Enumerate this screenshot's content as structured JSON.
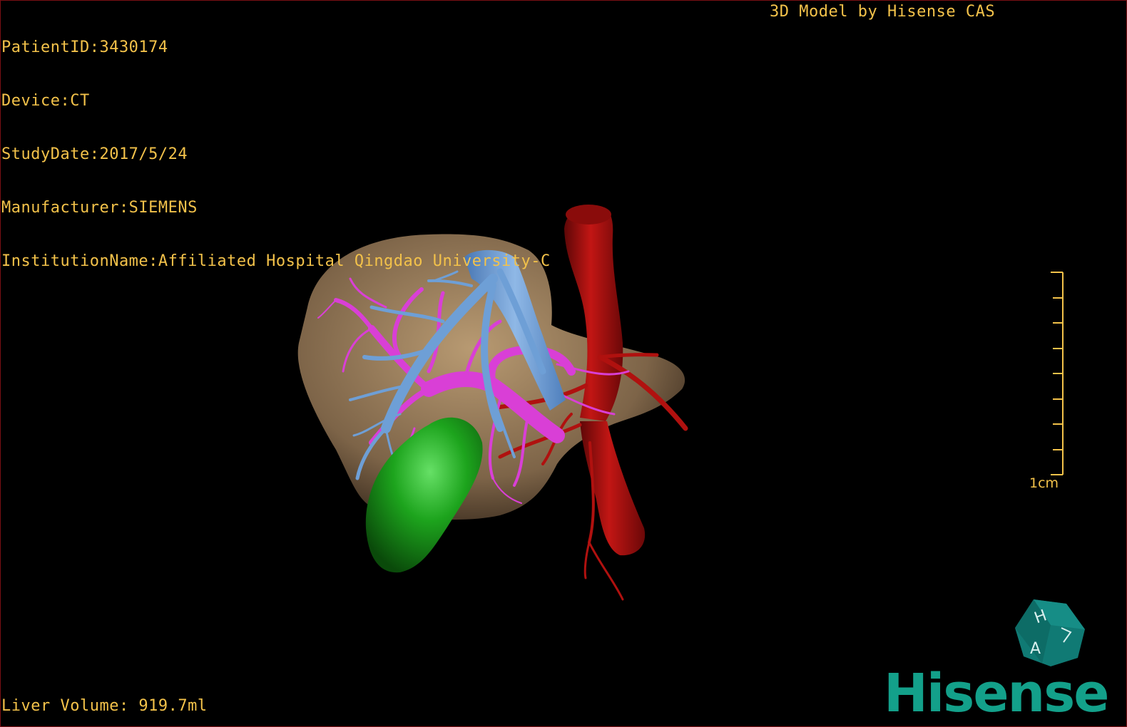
{
  "overlay": {
    "patient_id": "PatientID:3430174",
    "device": "Device:CT",
    "study_date": "StudyDate:2017/5/24",
    "manufacturer": "Manufacturer:SIEMENS",
    "institution": "InstitutionName:Affiliated Hospital Qingdao University-C",
    "model_credit": "3D Model by Hisense CAS",
    "liver_volume": "Liver Volume: 919.7ml"
  },
  "scale_bar": {
    "label": "1cm"
  },
  "orientation_cube": {
    "icon": "orientation-cube-icon",
    "faces": [
      "H",
      "A"
    ]
  },
  "branding": {
    "wordmark": "Hisense"
  },
  "colors": {
    "overlay_text": "#f3c24a",
    "liver": "#7d6448",
    "hepatic_vein": "#6e9fd6",
    "portal_vein": "#d93fd6",
    "artery_ivc": "#b0110f",
    "gallbladder": "#1c9a1c",
    "brand": "#13a08a"
  }
}
